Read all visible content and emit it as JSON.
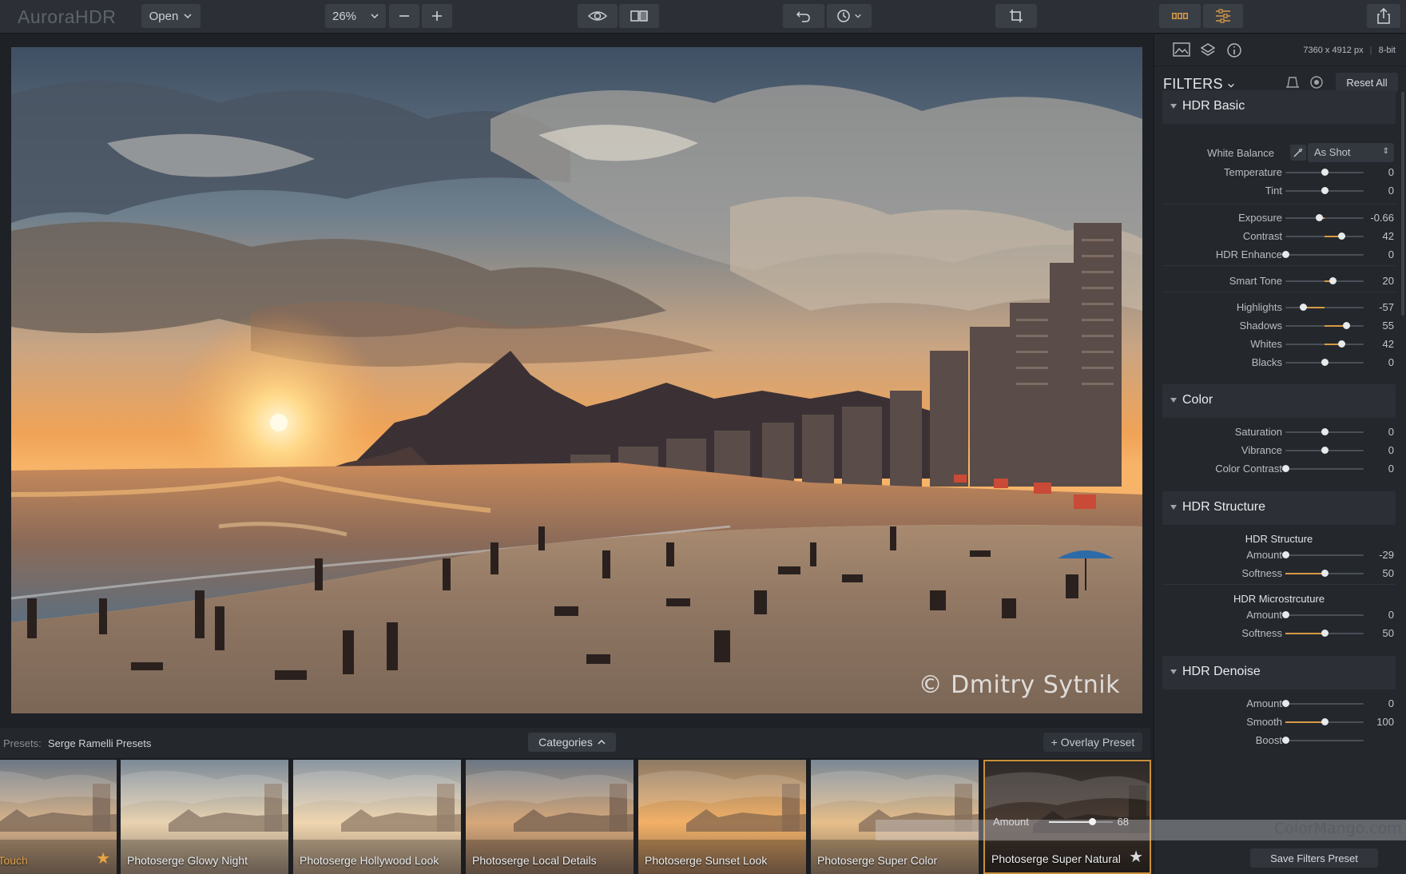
{
  "app": {
    "title": "AuroraHDR"
  },
  "toolbar": {
    "open_label": "Open",
    "zoom_value": "26%"
  },
  "photo": {
    "credit": "© Dmitry Sytnik"
  },
  "presets": {
    "label": "Presets:",
    "name": "Serge Ramelli Presets",
    "categories_label": "Categories",
    "overlay_label": "+ Overlay Preset",
    "items": [
      {
        "label": "ge Final Touch",
        "starred": true
      },
      {
        "label": "Photoserge Glowy Night",
        "starred": false
      },
      {
        "label": "Photoserge Hollywood Look",
        "starred": false
      },
      {
        "label": "Photoserge Local Details",
        "starred": false
      },
      {
        "label": "Photoserge Sunset Look",
        "starred": false
      },
      {
        "label": "Photoserge Super Color",
        "starred": false
      },
      {
        "label": "Photoserge Super Natural",
        "starred": true,
        "selected": true
      }
    ],
    "selected_amount_label": "Amount",
    "selected_amount_value": "68",
    "selected_amount": 0.68
  },
  "panel": {
    "image_info": "7360 x 4912 px",
    "bit_depth": "8-bit",
    "filters_title": "FILTERS",
    "reset_label": "Reset All",
    "save_label": "Save Filters Preset",
    "hdr_basic": {
      "title": "HDR Basic",
      "white_balance_label": "White Balance",
      "white_balance_value": "As Shot",
      "sliders": [
        {
          "label": "Temperature",
          "value": "0",
          "pos": 0.5,
          "center": true
        },
        {
          "label": "Tint",
          "value": "0",
          "pos": 0.5,
          "center": true
        },
        {
          "label": "Exposure",
          "value": "-0.66",
          "pos": 0.43,
          "center": true
        },
        {
          "label": "Contrast",
          "value": "42",
          "pos": 0.71,
          "center": true
        },
        {
          "label": "HDR Enhance",
          "value": "0",
          "pos": 0.0,
          "center": false
        },
        {
          "label": "Smart Tone",
          "value": "20",
          "pos": 0.6,
          "center": true
        },
        {
          "label": "Highlights",
          "value": "-57",
          "pos": 0.22,
          "center": true
        },
        {
          "label": "Shadows",
          "value": "55",
          "pos": 0.78,
          "center": true
        },
        {
          "label": "Whites",
          "value": "42",
          "pos": 0.71,
          "center": true
        },
        {
          "label": "Blacks",
          "value": "0",
          "pos": 0.5,
          "center": true
        }
      ]
    },
    "color": {
      "title": "Color",
      "sliders": [
        {
          "label": "Saturation",
          "value": "0",
          "pos": 0.5,
          "center": true
        },
        {
          "label": "Vibrance",
          "value": "0",
          "pos": 0.5,
          "center": true
        },
        {
          "label": "Color Contrast",
          "value": "0",
          "pos": 0.0,
          "center": false
        }
      ]
    },
    "hdr_structure": {
      "title": "HDR Structure",
      "sub1": "HDR Structure",
      "sub1_sliders": [
        {
          "label": "Amount",
          "value": "-29",
          "pos": 0.0,
          "center": false
        },
        {
          "label": "Softness",
          "value": "50",
          "pos": 0.5,
          "center": false
        }
      ],
      "sub2": "HDR Microstrcuture",
      "sub2_sliders": [
        {
          "label": "Amount",
          "value": "0",
          "pos": 0.0,
          "center": false
        },
        {
          "label": "Softness",
          "value": "50",
          "pos": 0.5,
          "center": false
        }
      ]
    },
    "hdr_denoise": {
      "title": "HDR Denoise",
      "sliders": [
        {
          "label": "Amount",
          "value": "0",
          "pos": 0.0,
          "center": false
        },
        {
          "label": "Smooth",
          "value": "100",
          "pos": 0.5,
          "center": false
        },
        {
          "label": "Boost",
          "value": "",
          "pos": 0.0,
          "center": false
        }
      ]
    }
  },
  "watermark": {
    "text": "ColorMango.com"
  },
  "colors": {
    "accent": "#d99a45",
    "selected_border": "#c8903a"
  }
}
